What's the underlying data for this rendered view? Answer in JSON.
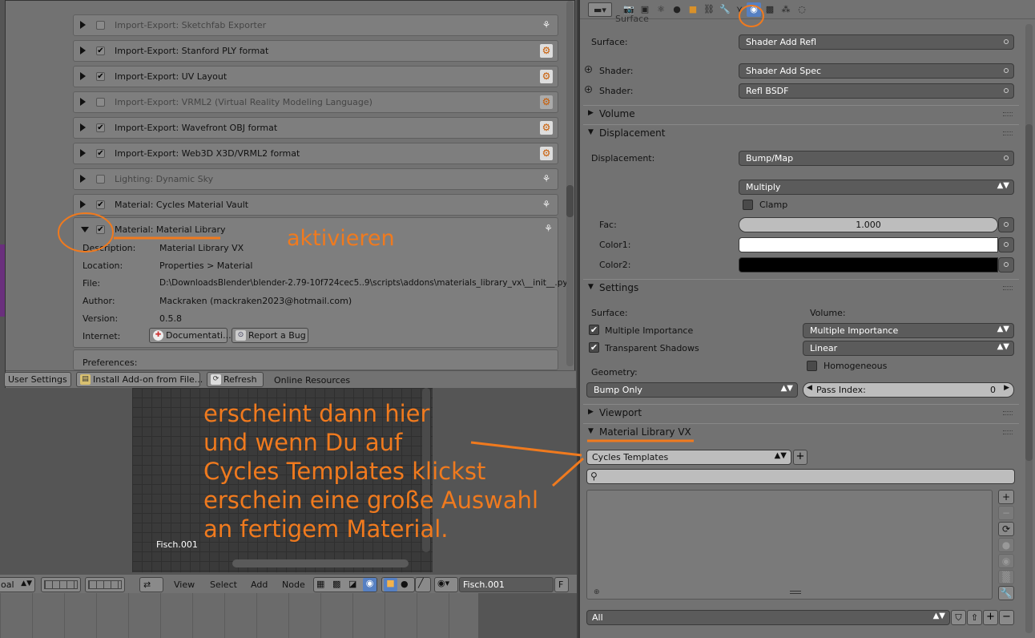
{
  "addons": [
    {
      "label": "Import-Export: Sketchfab Exporter",
      "enabled": false,
      "icon": "user-addon-icon"
    },
    {
      "label": "Import-Export: Stanford PLY format",
      "enabled": true,
      "icon": "official-addon-icon"
    },
    {
      "label": "Import-Export: UV Layout",
      "enabled": true,
      "icon": "official-addon-icon"
    },
    {
      "label": "Import-Export: VRML2 (Virtual Reality Modeling Language)",
      "enabled": false,
      "icon": "official-addon-icon"
    },
    {
      "label": "Import-Export: Wavefront OBJ format",
      "enabled": true,
      "icon": "official-addon-icon"
    },
    {
      "label": "Import-Export: Web3D X3D/VRML2 format",
      "enabled": true,
      "icon": "official-addon-icon"
    },
    {
      "label": "Lighting: Dynamic Sky",
      "enabled": false,
      "icon": "user-addon-icon"
    },
    {
      "label": "Material: Cycles Material Vault",
      "enabled": true,
      "icon": "user-addon-icon"
    }
  ],
  "expanded_addon": {
    "label": "Material: Material Library",
    "enabled": true,
    "description_label": "Description:",
    "description": "Material Library VX",
    "location_label": "Location:",
    "location": "Properties > Material",
    "file_label": "File:",
    "file": "D:\\DownloadsBlender\\blender-2.79-10f724cec5..9\\scripts\\addons\\materials_library_vx\\__init__.py",
    "author_label": "Author:",
    "author": "Mackraken (mackraken2023@hotmail.com)",
    "version_label": "Version:",
    "version": "0.5.8",
    "internet_label": "Internet:",
    "documentation_button": "Documentati...",
    "report_bug_button": "Report a Bug",
    "preferences_label": "Preferences:"
  },
  "prefs_footer": {
    "user_settings": "User Settings",
    "install_addon": "Install Add-on from File...",
    "refresh": "Refresh",
    "online_resources": "Online Resources"
  },
  "properties": {
    "surface_header_partial": "Surface",
    "surface_label": "Surface:",
    "surface_value": "Shader Add Refl",
    "shader1_label": "Shader:",
    "shader1_value": "Shader Add Spec",
    "shader2_label": "Shader:",
    "shader2_value": "Refl BSDF",
    "volume_section": "Volume",
    "displacement_section": "Displacement",
    "displacement_label": "Displacement:",
    "displacement_value": "Bump/Map",
    "blend_mode": "Multiply",
    "clamp_label": "Clamp",
    "clamp_checked": false,
    "fac_label": "Fac:",
    "fac_value": "1.000",
    "color1_label": "Color1:",
    "color1": "#ffffff",
    "color2_label": "Color2:",
    "color2": "#000000",
    "settings_section": "Settings",
    "surface_col_label": "Surface:",
    "volume_col_label": "Volume:",
    "multiple_importance_label": "Multiple Importance",
    "multiple_importance_checked": true,
    "transparent_shadows_label": "Transparent Shadows",
    "transparent_shadows_checked": true,
    "volume_sampling": "Multiple Importance",
    "volume_interpolation": "Linear",
    "homogeneous_label": "Homogeneous",
    "homogeneous_checked": false,
    "geometry_label": "Geometry:",
    "displacement_method": "Bump Only",
    "pass_index_label": "Pass Index:",
    "pass_index_value": "0",
    "viewport_section": "Viewport",
    "matlib_section": "Material Library VX",
    "library_select": "Cycles Templates",
    "category_select": "All"
  },
  "node_editor": {
    "object_label": "Fisch.001",
    "header_left_select": "oal",
    "menu_view": "View",
    "menu_select": "Select",
    "menu_add": "Add",
    "menu_node": "Node",
    "material_field": "Fisch.001",
    "fake_user": "F"
  },
  "annotations": {
    "activate": "aktivieren",
    "explanation": [
      "erscheint dann hier",
      "und wenn Du auf",
      "Cycles Templates klickst",
      "erschein eine große Auswahl",
      "an fertigem Material."
    ],
    "color": "#f07a1e"
  }
}
